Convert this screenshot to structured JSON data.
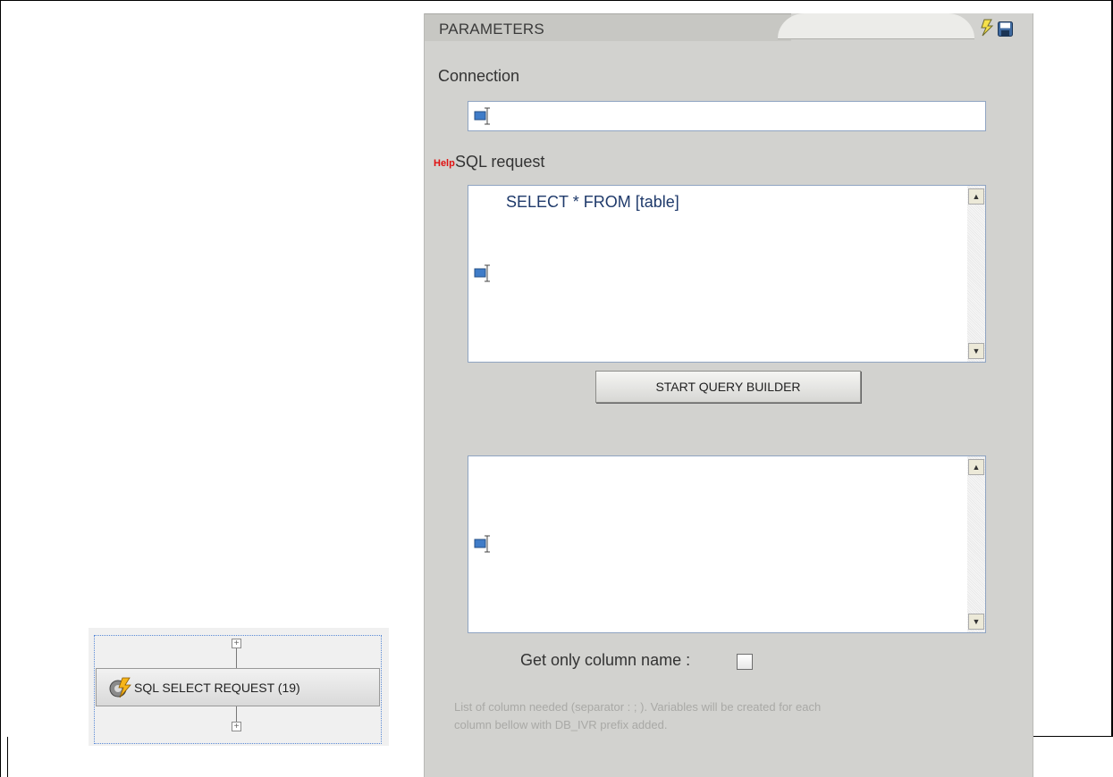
{
  "panel": {
    "title": "PARAMETERS",
    "connection_label": "Connection",
    "connection_value": "",
    "help_link": "Help",
    "sql_label": "SQL request",
    "sql_value": "SELECT * FROM [table]",
    "query_builder_button": "START QUERY BUILDER",
    "columns_value": "",
    "get_column_name_label": "Get only column name :",
    "get_column_name_checked": false,
    "description_line1": "List of column needed (separator : ; ). Variables will be created for each",
    "description_line2": "column bellow with DB_IVR prefix added."
  },
  "toolbar_icons": [
    "lightning-icon",
    "save-icon"
  ],
  "node": {
    "label": "SQL SELECT REQUEST (19)",
    "icon": "sql-gear-icon"
  },
  "colors": {
    "panel_bg": "#d2d2cf",
    "sql_text": "#1f3a6b",
    "help": "#e01010"
  }
}
